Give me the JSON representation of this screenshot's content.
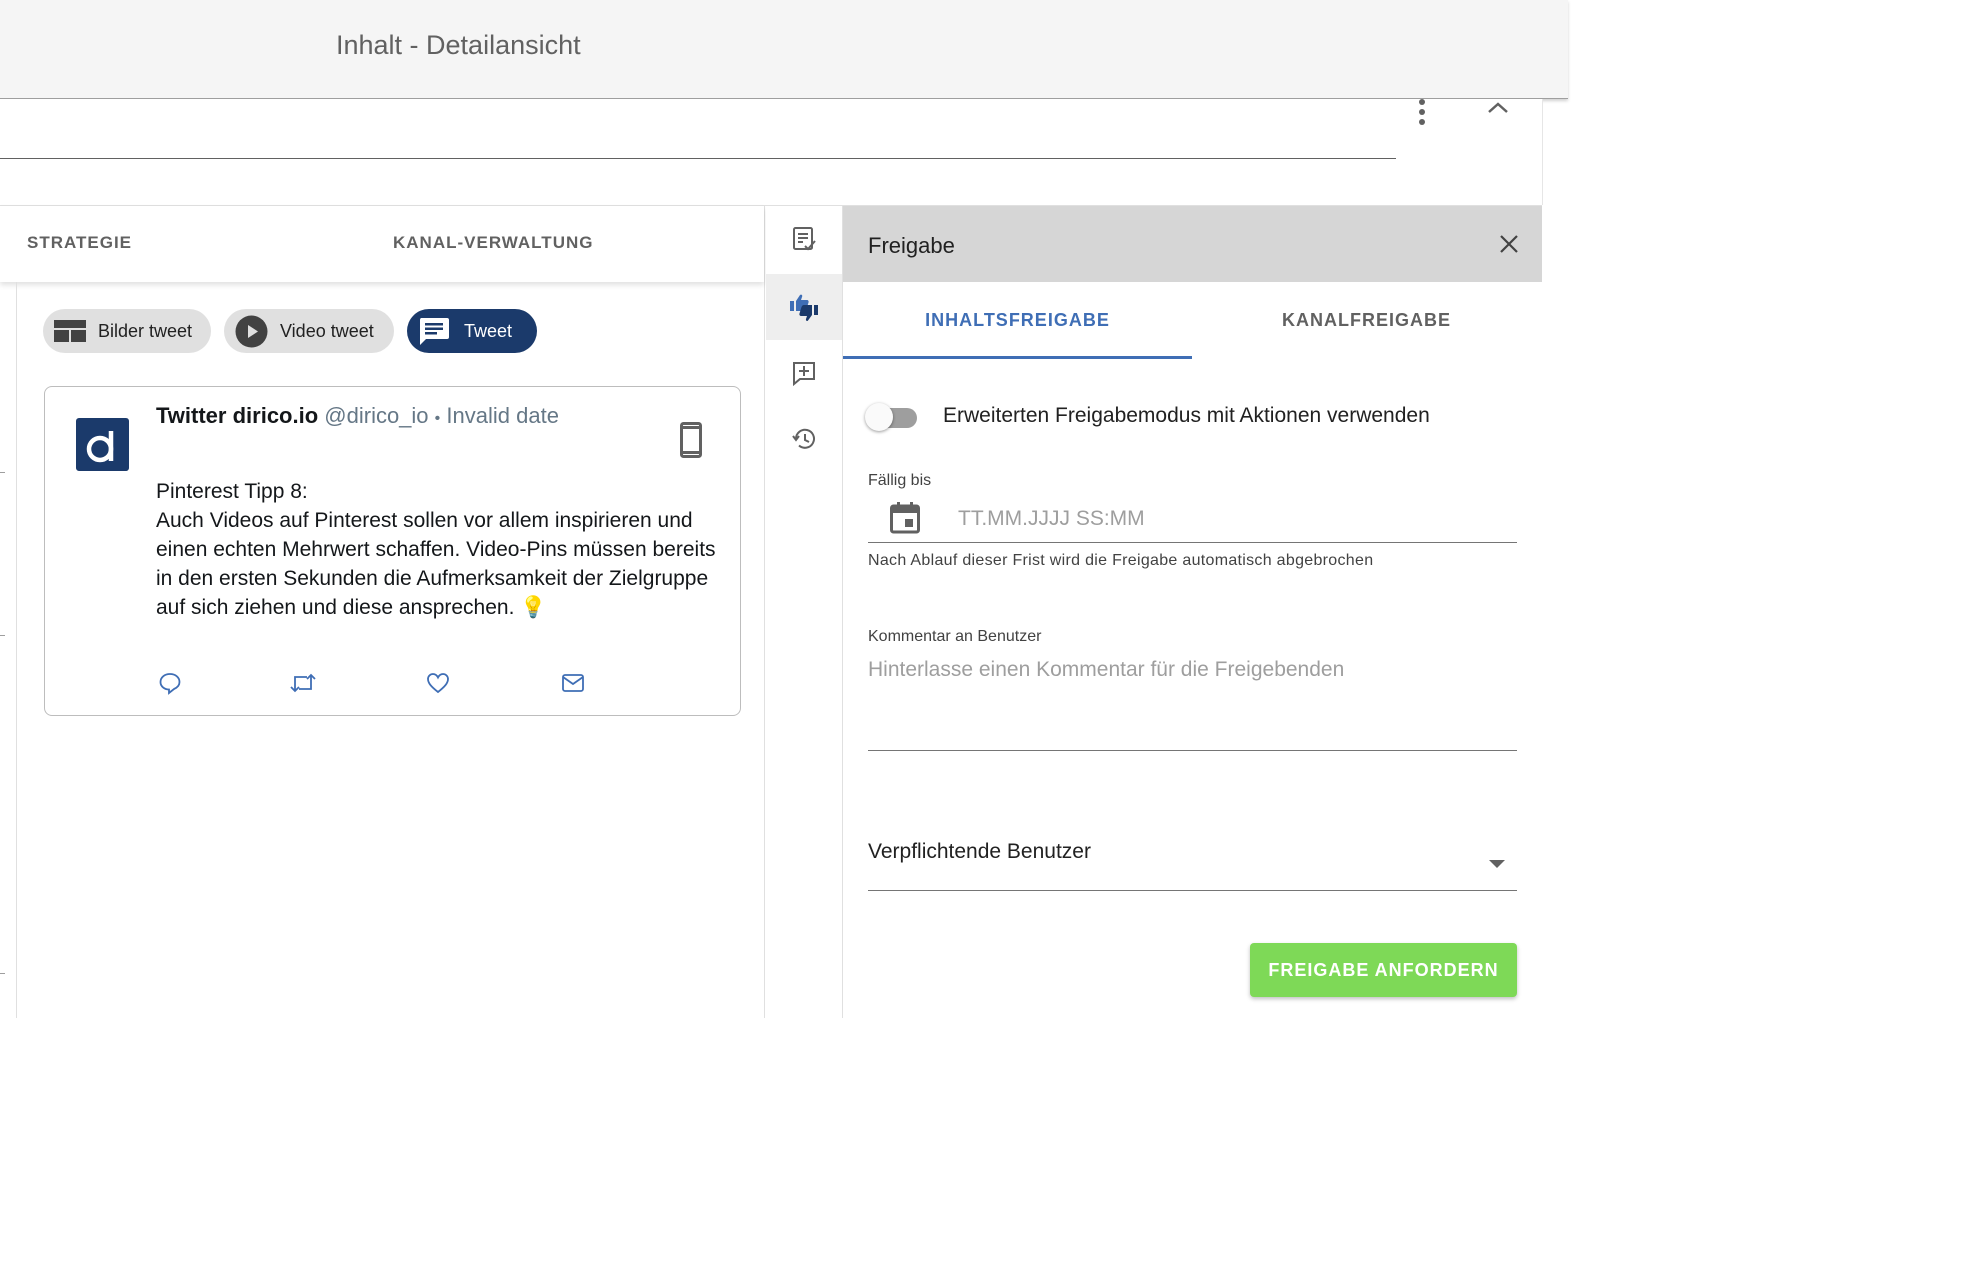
{
  "header": {
    "title": "Inhalt - Detailansicht"
  },
  "left": {
    "tabs": [
      {
        "label": "STRATEGIE"
      },
      {
        "label": "KANAL-VERWALTUNG"
      }
    ],
    "chips": [
      {
        "label": "Bilder tweet",
        "icon": "image-grid-icon",
        "active": false
      },
      {
        "label": "Video tweet",
        "icon": "play-icon",
        "active": false
      },
      {
        "label": "Tweet",
        "icon": "message-icon",
        "active": true
      }
    ],
    "tweet": {
      "account_name": "Twitter dirico.io",
      "handle": "@dirico_io",
      "separator": "•",
      "date": "Invalid date",
      "avatar_letter": "d",
      "text": "Pinterest Tipp 8:\nAuch Videos auf Pinterest sollen vor allem inspirieren und einen echten Mehrwert schaffen. Video-Pins müssen bereits in den ersten Sekunden die Aufmerksamkeit der Zielgruppe auf sich ziehen und diese ansprechen. 💡",
      "actions": [
        "reply-icon",
        "retweet-icon",
        "like-icon",
        "mail-icon"
      ]
    }
  },
  "sidebar_icons": [
    {
      "name": "content-check-icon",
      "active": false
    },
    {
      "name": "approval-thumbs-icon",
      "active": true
    },
    {
      "name": "add-comment-icon",
      "active": false
    },
    {
      "name": "history-icon",
      "active": false
    }
  ],
  "freigabe": {
    "title": "Freigabe",
    "tabs": [
      {
        "label": "INHALTSFREIGABE",
        "active": true
      },
      {
        "label": "KANALFREIGABE",
        "active": false
      }
    ],
    "toggle": {
      "label": "Erweiterten Freigabemodus mit Aktionen verwenden",
      "checked": false
    },
    "due": {
      "label": "Fällig bis",
      "placeholder": "TT.MM.JJJJ SS:MM",
      "hint": "Nach Ablauf dieser Frist wird die Freigabe automatisch abgebrochen"
    },
    "comment": {
      "label": "Kommentar an Benutzer",
      "placeholder": "Hinterlasse einen Kommentar für die Freigebenden"
    },
    "users_select": {
      "label": "Verpflichtende Benutzer"
    },
    "submit_label": "FREIGABE ANFORDERN"
  },
  "colors": {
    "accent_blue": "#3f6eb5",
    "navy": "#1b3a6b",
    "submit_green": "#7ed957",
    "panel_header_grey": "#d6d6d6"
  }
}
